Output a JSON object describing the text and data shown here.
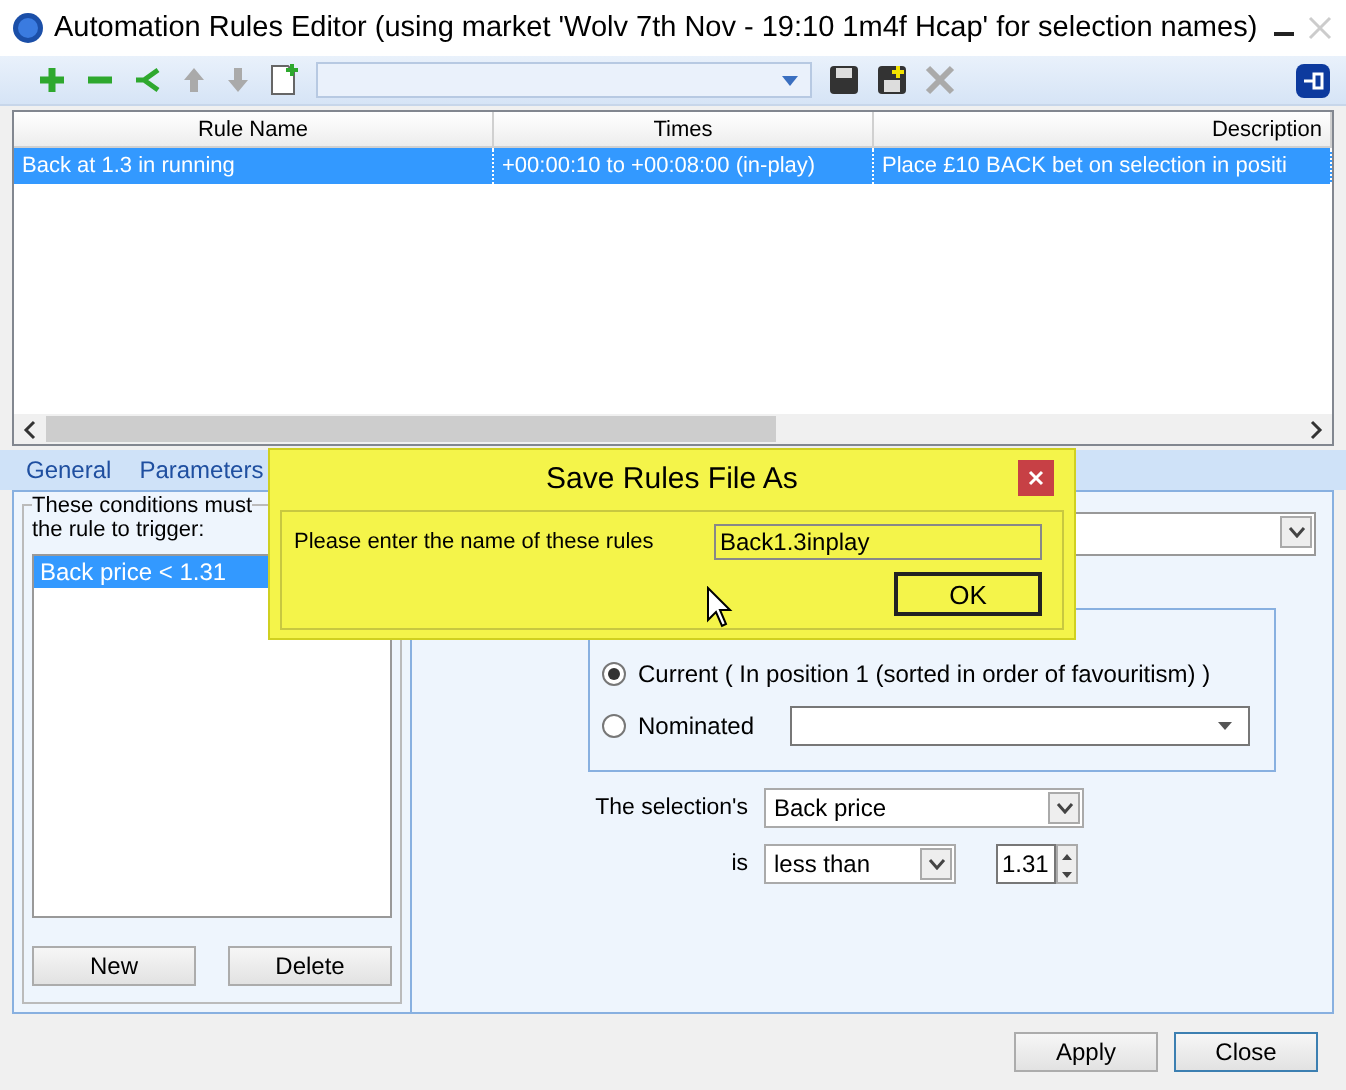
{
  "window": {
    "title": "Automation Rules Editor (using market 'Wolv 7th Nov - 19:10 1m4f Hcap' for selection names)"
  },
  "rules_table": {
    "columns": [
      "Rule Name",
      "Times",
      "Description"
    ],
    "rows": [
      {
        "cells": [
          "Back at 1.3 in running",
          "+00:00:10 to +00:08:00 (in-play)",
          "Place £10 BACK bet on selection in positi"
        ],
        "selected": true
      }
    ]
  },
  "tabs": [
    {
      "label": "General",
      "selected": false
    },
    {
      "label": "Parameters",
      "selected": false
    }
  ],
  "conditions": {
    "caption_lines": [
      "These conditions must",
      "the rule to trigger:"
    ],
    "items": [
      {
        "label": "Back price < 1.31",
        "selected": true
      }
    ],
    "buttons": [
      "New",
      "Delete"
    ]
  },
  "selection": {
    "options": [
      {
        "label": "Current ( In position 1 (sorted in order of favouritism) )",
        "checked": true
      },
      {
        "label": "Nominated",
        "checked": false
      }
    ]
  },
  "criteria": {
    "field_label": "The selection's",
    "field": "Back price",
    "operator_label": "is",
    "operator": "less than",
    "value": "1.31"
  },
  "buttons": [
    "Apply",
    "Close"
  ],
  "dialog": {
    "title": "Save Rules File As",
    "prompt": "Please enter the name of these rules",
    "value": "Back1.3inplay",
    "button": "OK"
  }
}
